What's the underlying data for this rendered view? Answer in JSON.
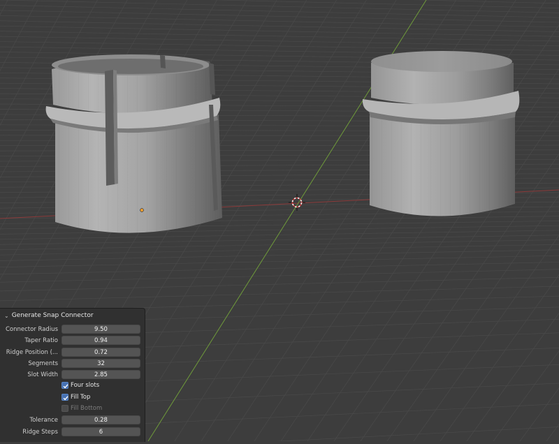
{
  "panel": {
    "title": "Generate Snap Connector",
    "params": [
      {
        "label": "Connector Radius",
        "value": "9.50"
      },
      {
        "label": "Taper Ratio",
        "value": "0.94"
      },
      {
        "label": "Ridge Position (...",
        "value": "0.72"
      },
      {
        "label": "Segments",
        "value": "32"
      },
      {
        "label": "Slot Width",
        "value": "2.85"
      }
    ],
    "checkboxes": [
      {
        "label": "Four slots",
        "checked": true
      },
      {
        "label": "Fill Top",
        "checked": true
      },
      {
        "label": "Fill Bottom",
        "checked": false
      }
    ],
    "params2": [
      {
        "label": "Tolerance",
        "value": "0.28"
      },
      {
        "label": "Ridge Steps",
        "value": "6"
      }
    ]
  },
  "colors": {
    "viewport_bg": "#3d3d3d",
    "grid": "#4a4a4a",
    "x_axis": "#8b3a3a",
    "y_axis": "#6e9a3a",
    "mesh_light": "#a9a9a9",
    "mesh_dark": "#6a6a6a",
    "checkbox_on": "#4772b3"
  },
  "icons": {
    "panel_collapse": "chevron-down-icon",
    "cursor": "3d-cursor-icon",
    "origin": "object-origin-icon"
  }
}
